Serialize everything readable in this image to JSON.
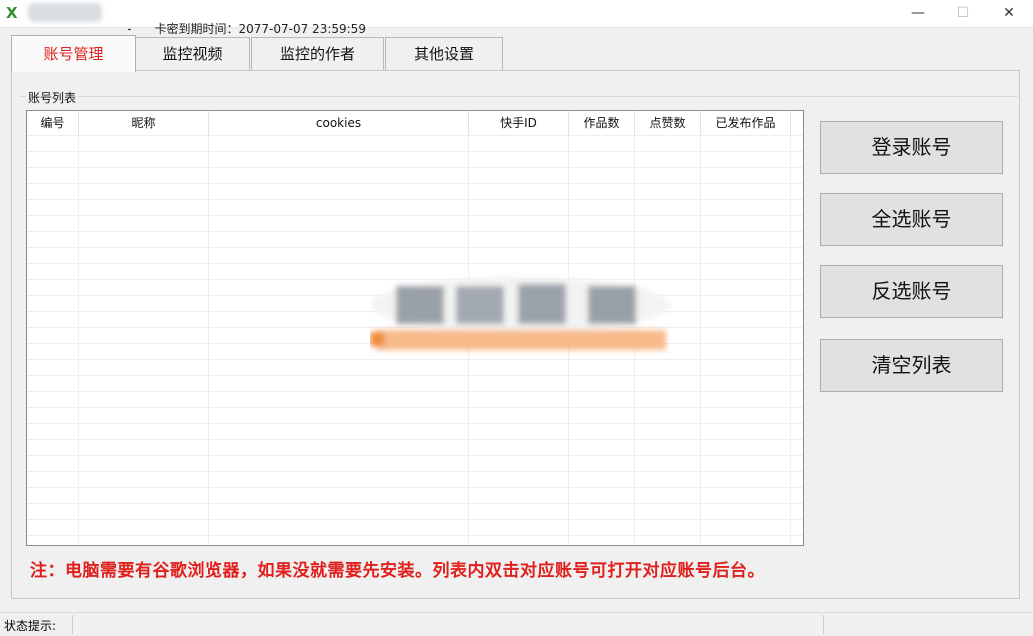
{
  "window": {
    "title_prefix": "-",
    "title_text": "卡密到期时间：2077-07-07 23:59:59",
    "min_glyph": "—",
    "max_glyph": "☐",
    "close_glyph": "✕",
    "icon": "green-x-icon"
  },
  "tabs": [
    {
      "label": "账号管理",
      "active": true
    },
    {
      "label": "监控视频",
      "active": false
    },
    {
      "label": "监控的作者",
      "active": false
    },
    {
      "label": "其他设置",
      "active": false
    }
  ],
  "group": {
    "title": "账号列表"
  },
  "table": {
    "columns": [
      "编号",
      "昵称",
      "cookies",
      "快手ID",
      "作品数",
      "点赞数",
      "已发布作品"
    ],
    "rows": []
  },
  "buttons": {
    "login": "登录账号",
    "select_all": "全选账号",
    "invert": "反选账号",
    "clear": "清空列表"
  },
  "note": "注：电脑需要有谷歌浏览器，如果没就需要先安装。列表内双击对应账号可打开对应账号后台。",
  "status": {
    "label": "状态提示:"
  },
  "colors": {
    "accent_red": "#e0201c",
    "icon_green": "#2f8f2f"
  }
}
